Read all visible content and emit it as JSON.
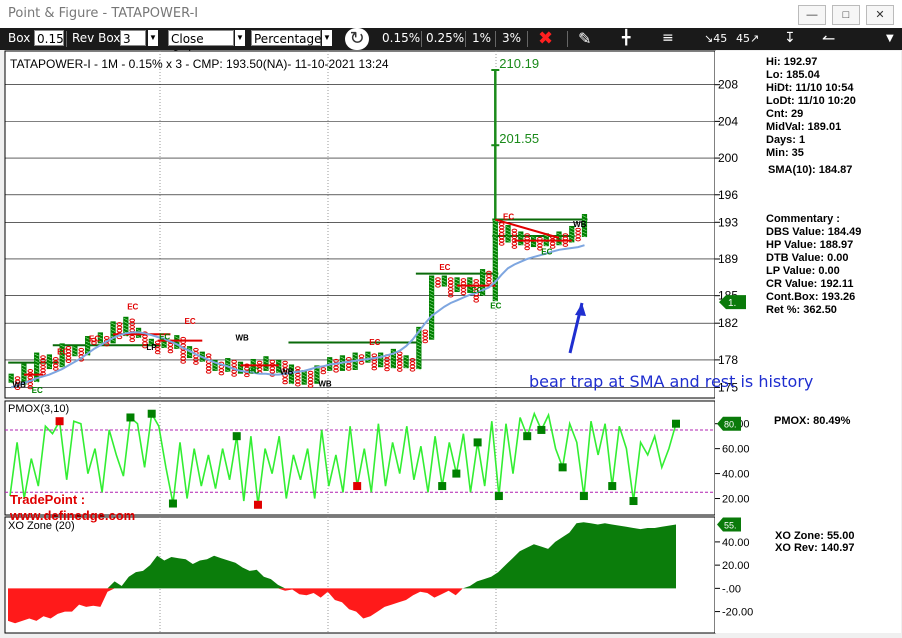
{
  "window": {
    "title": "Point & Figure - TATAPOWER-I",
    "minimize_icon": "minimize-icon",
    "restore_icon": "restore-icon",
    "close_icon": "close-icon"
  },
  "toolbar": {
    "box_label": "Box",
    "box_value": "0.15",
    "rev_label": "Rev Box",
    "rev_value": "3",
    "mode_value": "Close Only",
    "scale_value": "Percentage",
    "presets": [
      "0.15%",
      "0.25%",
      "1%",
      "3%"
    ],
    "icons": [
      "refresh-icon",
      "close-x-icon",
      "draw-icon",
      "candle-icon",
      "lines-icon",
      "angle-45-down-icon",
      "angle-45-up-icon",
      "pin-icon",
      "step-icon"
    ]
  },
  "chart_header": "TATAPOWER-I - 1M - 0.15% x 3 - CMP: 193.50(NA)- 11-10-2021 13:24",
  "stats": {
    "hi": "Hi: 192.97",
    "lo": "Lo: 185.04",
    "hidt": "HiDt: 11/10 10:54",
    "lodt": "LoDt: 11/10 10:20",
    "cnt": "Cnt: 29",
    "midval": "MidVal: 189.01",
    "days": "Days: 1",
    "min": "Min: 35",
    "sma": "SMA(10): 184.87"
  },
  "commentary": {
    "title": "Commentary :",
    "dbs": "DBS Value:  184.49",
    "hp": "HP Value: 188.97",
    "dtb": "DTB Value: 0.00",
    "lp": "LP Value: 0.00",
    "cr": "CR Value: 192.11",
    "cont": "Cont.Box: 193.26",
    "ret": "Ret %: 362.50"
  },
  "annotation": "bear trap at SMA and rest is history",
  "brand": {
    "line1": "TradePoint :",
    "line2": "www.definedge.com"
  },
  "pmox_panel": {
    "label": "PMOX(3,10)",
    "readout": "PMOX: 80.49%",
    "marker": "80."
  },
  "xo_panel": {
    "label": "XO Zone (20)",
    "readout1": "XO Zone: 55.00",
    "readout2": "XO Rev: 140.97",
    "marker": "55."
  },
  "colors": {
    "bull": "#008000",
    "bear": "#e00000",
    "sma": "#7ea6e0",
    "pmox_line": "#33ee33",
    "level": "#0a6a0a",
    "target": "#1a8a1a",
    "arrow": "#1f2ed0"
  },
  "chart_data": [
    {
      "type": "line",
      "name": "price_pnf",
      "yticks": [
        175,
        178,
        182,
        185,
        189,
        193,
        196,
        200,
        204,
        208
      ],
      "ylim": [
        174.5,
        210.8
      ],
      "columns": [
        {
          "t": "X",
          "lo": 175.5,
          "hi": 176.5
        },
        {
          "t": "O",
          "lo": 174.8,
          "hi": 176.2
        },
        {
          "t": "X",
          "lo": 175.3,
          "hi": 177.6
        },
        {
          "t": "O",
          "lo": 175.0,
          "hi": 177.0
        },
        {
          "t": "X",
          "lo": 175.6,
          "hi": 178.8
        },
        {
          "t": "O",
          "lo": 176.4,
          "hi": 178.5
        },
        {
          "t": "X",
          "lo": 177.0,
          "hi": 178.6
        },
        {
          "t": "O",
          "lo": 176.8,
          "hi": 178.3
        },
        {
          "t": "X",
          "lo": 177.2,
          "hi": 179.8
        },
        {
          "t": "O",
          "lo": 177.8,
          "hi": 179.5
        },
        {
          "t": "X",
          "lo": 178.4,
          "hi": 179.6
        },
        {
          "t": "O",
          "lo": 178.0,
          "hi": 179.3
        },
        {
          "t": "X",
          "lo": 178.5,
          "hi": 180.6
        },
        {
          "t": "O",
          "lo": 179.6,
          "hi": 180.4
        },
        {
          "t": "X",
          "lo": 179.8,
          "hi": 181.0
        },
        {
          "t": "O",
          "lo": 179.4,
          "hi": 180.6
        },
        {
          "t": "X",
          "lo": 179.8,
          "hi": 182.2
        },
        {
          "t": "O",
          "lo": 180.2,
          "hi": 182.1
        },
        {
          "t": "X",
          "lo": 180.6,
          "hi": 182.7
        },
        {
          "t": "O",
          "lo": 180.0,
          "hi": 182.5
        },
        {
          "t": "X",
          "lo": 180.4,
          "hi": 181.5
        },
        {
          "t": "O",
          "lo": 179.4,
          "hi": 181.1
        },
        {
          "t": "X",
          "lo": 179.6,
          "hi": 180.3
        },
        {
          "t": "O",
          "lo": 178.8,
          "hi": 180.1
        },
        {
          "t": "X",
          "lo": 179.3,
          "hi": 180.4
        },
        {
          "t": "O",
          "lo": 178.6,
          "hi": 180.2
        },
        {
          "t": "X",
          "lo": 179.2,
          "hi": 180.7
        },
        {
          "t": "O",
          "lo": 177.6,
          "hi": 180.5
        },
        {
          "t": "X",
          "lo": 178.2,
          "hi": 179.5
        },
        {
          "t": "O",
          "lo": 177.4,
          "hi": 179.3
        },
        {
          "t": "X",
          "lo": 177.8,
          "hi": 178.9
        },
        {
          "t": "O",
          "lo": 176.5,
          "hi": 178.7
        },
        {
          "t": "X",
          "lo": 176.8,
          "hi": 178.0
        },
        {
          "t": "O",
          "lo": 176.4,
          "hi": 177.8
        },
        {
          "t": "X",
          "lo": 176.7,
          "hi": 178.2
        },
        {
          "t": "O",
          "lo": 176.2,
          "hi": 178.0
        },
        {
          "t": "X",
          "lo": 176.5,
          "hi": 177.8
        },
        {
          "t": "O",
          "lo": 176.3,
          "hi": 177.6
        },
        {
          "t": "X",
          "lo": 176.5,
          "hi": 178.1
        },
        {
          "t": "O",
          "lo": 176.4,
          "hi": 177.9
        },
        {
          "t": "X",
          "lo": 176.8,
          "hi": 178.4
        },
        {
          "t": "O",
          "lo": 176.3,
          "hi": 178.0
        },
        {
          "t": "X",
          "lo": 176.6,
          "hi": 178.0
        },
        {
          "t": "O",
          "lo": 175.2,
          "hi": 177.9
        },
        {
          "t": "X",
          "lo": 175.4,
          "hi": 177.5
        },
        {
          "t": "O",
          "lo": 175.0,
          "hi": 177.3
        },
        {
          "t": "X",
          "lo": 175.3,
          "hi": 176.9
        },
        {
          "t": "O",
          "lo": 175.0,
          "hi": 176.8
        },
        {
          "t": "X",
          "lo": 175.4,
          "hi": 177.4
        },
        {
          "t": "O",
          "lo": 176.6,
          "hi": 177.2
        },
        {
          "t": "X",
          "lo": 176.8,
          "hi": 178.3
        },
        {
          "t": "O",
          "lo": 176.6,
          "hi": 178.1
        },
        {
          "t": "X",
          "lo": 176.8,
          "hi": 178.5
        },
        {
          "t": "O",
          "lo": 176.7,
          "hi": 178.3
        },
        {
          "t": "X",
          "lo": 176.9,
          "hi": 178.8
        },
        {
          "t": "O",
          "lo": 177.5,
          "hi": 178.6
        },
        {
          "t": "X",
          "lo": 177.7,
          "hi": 178.9
        },
        {
          "t": "O",
          "lo": 177.0,
          "hi": 178.7
        },
        {
          "t": "X",
          "lo": 177.2,
          "hi": 178.8
        },
        {
          "t": "O",
          "lo": 176.9,
          "hi": 178.6
        },
        {
          "t": "X",
          "lo": 177.1,
          "hi": 179.2
        },
        {
          "t": "O",
          "lo": 176.8,
          "hi": 178.9
        },
        {
          "t": "X",
          "lo": 177.1,
          "hi": 178.5
        },
        {
          "t": "O",
          "lo": 176.8,
          "hi": 178.2
        },
        {
          "t": "X",
          "lo": 177.0,
          "hi": 181.6
        },
        {
          "t": "O",
          "lo": 180.0,
          "hi": 181.3
        },
        {
          "t": "X",
          "lo": 180.2,
          "hi": 187.2
        },
        {
          "t": "O",
          "lo": 185.8,
          "hi": 187.0
        },
        {
          "t": "X",
          "lo": 186.0,
          "hi": 187.2
        },
        {
          "t": "O",
          "lo": 185.0,
          "hi": 187.0
        },
        {
          "t": "X",
          "lo": 185.4,
          "hi": 187.0
        },
        {
          "t": "O",
          "lo": 185.1,
          "hi": 186.9
        },
        {
          "t": "X",
          "lo": 185.3,
          "hi": 187.0
        },
        {
          "t": "O",
          "lo": 184.4,
          "hi": 186.8
        },
        {
          "t": "X",
          "lo": 185.0,
          "hi": 187.9
        },
        {
          "t": "O",
          "lo": 186.1,
          "hi": 187.7
        },
        {
          "t": "X",
          "lo": 184.4,
          "hi": 193.4
        },
        {
          "t": "O",
          "lo": 190.4,
          "hi": 193.0
        },
        {
          "t": "X",
          "lo": 190.8,
          "hi": 192.7
        },
        {
          "t": "O",
          "lo": 190.2,
          "hi": 192.3
        },
        {
          "t": "X",
          "lo": 190.5,
          "hi": 192.0
        },
        {
          "t": "O",
          "lo": 190.0,
          "hi": 191.8
        },
        {
          "t": "X",
          "lo": 190.3,
          "hi": 191.6
        },
        {
          "t": "O",
          "lo": 190.0,
          "hi": 191.4
        },
        {
          "t": "X",
          "lo": 190.4,
          "hi": 191.8
        },
        {
          "t": "O",
          "lo": 190.2,
          "hi": 191.6
        },
        {
          "t": "X",
          "lo": 190.5,
          "hi": 192.0
        },
        {
          "t": "O",
          "lo": 190.4,
          "hi": 191.8
        },
        {
          "t": "X",
          "lo": 190.8,
          "hi": 192.6
        },
        {
          "t": "O",
          "lo": 191.1,
          "hi": 192.4
        },
        {
          "t": "X",
          "lo": 191.4,
          "hi": 193.9
        }
      ],
      "targets": [
        {
          "label": "210.19",
          "value": 209.6
        },
        {
          "label": "201.55",
          "value": 201.4
        }
      ],
      "sma": [
        175.0,
        175.2,
        175.5,
        175.7,
        176.0,
        176.2,
        176.4,
        176.7,
        177.0,
        177.4,
        177.8,
        178.2,
        178.7,
        179.2,
        179.6,
        180.0,
        180.4,
        180.7,
        180.9,
        181.0,
        181.0,
        180.9,
        180.7,
        180.5,
        180.3,
        180.0,
        179.7,
        179.3,
        179.0,
        178.6,
        178.3,
        178.0,
        177.7,
        177.5,
        177.3,
        177.0,
        176.8,
        176.7,
        176.6,
        176.5,
        176.5,
        176.4,
        176.4,
        176.5,
        176.6,
        176.7,
        176.8,
        177.0,
        177.2,
        177.3,
        177.5,
        177.6,
        177.7,
        177.8,
        177.9,
        178.0,
        178.1,
        178.2,
        178.3,
        178.5,
        178.7,
        179.0,
        179.5,
        180.2,
        181.1,
        182.0,
        182.8,
        183.3,
        183.8,
        184.2,
        184.5,
        184.8,
        185.1,
        185.3,
        185.6,
        185.9,
        186.5,
        187.3,
        188.0,
        188.4,
        188.7,
        189.0,
        189.2,
        189.4,
        189.6,
        189.8,
        190.0,
        190.1,
        190.2,
        190.3,
        190.5
      ],
      "levels": [
        {
          "value": 177.7,
          "from": 0,
          "to": 7
        },
        {
          "value": 179.6,
          "from": 7,
          "to": 23
        },
        {
          "value": 179.9,
          "from": 44,
          "to": 64
        },
        {
          "value": 187.4,
          "from": 64,
          "to": 76
        },
        {
          "value": 193.3,
          "from": 76,
          "to": 90
        },
        {
          "value": 191.5,
          "from": 76,
          "to": 88
        }
      ],
      "red_lines": [
        {
          "x1": 2,
          "y1": 176.4,
          "x2": 5,
          "y2": 176.4
        },
        {
          "x1": 16,
          "y1": 180.8,
          "x2": 25,
          "y2": 180.8
        },
        {
          "x1": 23,
          "y1": 180.1,
          "x2": 30,
          "y2": 180.1
        },
        {
          "x1": 36,
          "y1": 177.4,
          "x2": 42,
          "y2": 177.4
        },
        {
          "x1": 70,
          "y1": 186.1,
          "x2": 76,
          "y2": 186.1
        },
        {
          "x1": 76,
          "y1": 193.3,
          "x2": 86,
          "y2": 191.3
        },
        {
          "x1": 79,
          "y1": 191.0,
          "x2": 88,
          "y2": 191.0
        }
      ],
      "labels": [
        {
          "text": "WB",
          "x": 1,
          "y": 175.0,
          "color": "#000000"
        },
        {
          "text": "EC",
          "x": 4,
          "y": 174.4,
          "color": "#008000"
        },
        {
          "text": "EC",
          "x": 8,
          "y": 178.6,
          "color": "#e00000"
        },
        {
          "text": "EC",
          "x": 13,
          "y": 180.0,
          "color": "#e00000"
        },
        {
          "text": "EC",
          "x": 19,
          "y": 183.5,
          "color": "#e00000"
        },
        {
          "text": "LP",
          "x": 22,
          "y": 179.1,
          "color": "#000000"
        },
        {
          "text": "EC",
          "x": 24,
          "y": 180.2,
          "color": "#008000"
        },
        {
          "text": "EC",
          "x": 28,
          "y": 181.9,
          "color": "#e00000"
        },
        {
          "text": "WB",
          "x": 36,
          "y": 180.1,
          "color": "#000000"
        },
        {
          "text": "EC",
          "x": 38,
          "y": 176.5,
          "color": "#008000"
        },
        {
          "text": "WB",
          "x": 43,
          "y": 176.4,
          "color": "#000000"
        },
        {
          "text": "WB",
          "x": 49,
          "y": 175.1,
          "color": "#000000"
        },
        {
          "text": "EC",
          "x": 57,
          "y": 179.6,
          "color": "#e00000"
        },
        {
          "text": "EC",
          "x": 68,
          "y": 187.8,
          "color": "#e00000"
        },
        {
          "text": "EC",
          "x": 73,
          "y": 185.3,
          "color": "#008000"
        },
        {
          "text": "EC",
          "x": 76,
          "y": 183.6,
          "color": "#008000"
        },
        {
          "text": "EC",
          "x": 78,
          "y": 193.3,
          "color": "#e00000"
        },
        {
          "text": "EC",
          "x": 84,
          "y": 189.5,
          "color": "#008000"
        },
        {
          "text": "WB",
          "x": 89,
          "y": 192.5,
          "color": "#000000"
        }
      ]
    },
    {
      "type": "line",
      "name": "pmox",
      "ylim": [
        10,
        95
      ],
      "yticks": [
        20,
        40,
        60,
        80
      ],
      "bands": [
        25,
        75
      ],
      "values": [
        22,
        65,
        20,
        52,
        30,
        78,
        72,
        82,
        35,
        82,
        80,
        40,
        60,
        25,
        75,
        55,
        38,
        85,
        80,
        45,
        88,
        78,
        45,
        16,
        65,
        20,
        60,
        30,
        55,
        28,
        60,
        35,
        70,
        18,
        70,
        15,
        60,
        40,
        70,
        20,
        55,
        35,
        60,
        20,
        75,
        30,
        55,
        25,
        78,
        30,
        60,
        25,
        80,
        30,
        65,
        40,
        78,
        35,
        62,
        25,
        70,
        30,
        65,
        40,
        72,
        25,
        65,
        30,
        82,
        22,
        80,
        40,
        85,
        70,
        88,
        75,
        87,
        60,
        45,
        80,
        65,
        22,
        82,
        55,
        80,
        30,
        78,
        60,
        18,
        65,
        55,
        70,
        45,
        60,
        80
      ],
      "markers": [
        {
          "i": 7,
          "c": "#e00000"
        },
        {
          "i": 17,
          "c": "#008000"
        },
        {
          "i": 20,
          "c": "#008000"
        },
        {
          "i": 23,
          "c": "#008000"
        },
        {
          "i": 32,
          "c": "#008000"
        },
        {
          "i": 35,
          "c": "#e00000"
        },
        {
          "i": 49,
          "c": "#e00000"
        },
        {
          "i": 61,
          "c": "#008000"
        },
        {
          "i": 63,
          "c": "#008000"
        },
        {
          "i": 66,
          "c": "#008000"
        },
        {
          "i": 69,
          "c": "#008000"
        },
        {
          "i": 73,
          "c": "#008000"
        },
        {
          "i": 75,
          "c": "#008000"
        },
        {
          "i": 78,
          "c": "#008000"
        },
        {
          "i": 81,
          "c": "#008000"
        },
        {
          "i": 85,
          "c": "#008000"
        },
        {
          "i": 88,
          "c": "#008000"
        },
        {
          "i": 94,
          "c": "#008000"
        }
      ]
    },
    {
      "type": "area",
      "name": "xo_zone",
      "ylim": [
        -35,
        58
      ],
      "yticks": [
        -20,
        0,
        20,
        40
      ],
      "ticklabels": [
        "-20.00",
        "-.00",
        "20.00",
        "40.00"
      ],
      "values": [
        -28,
        -30,
        -28,
        -26,
        -28,
        -24,
        -26,
        -22,
        -20,
        -20,
        -14,
        -16,
        -15,
        -16,
        -3,
        6,
        2,
        10,
        14,
        15,
        20,
        28,
        24,
        27,
        26,
        25,
        21,
        24,
        25,
        28,
        26,
        24,
        22,
        18,
        15,
        16,
        10,
        8,
        3,
        -2,
        -1,
        -5,
        -6,
        -4,
        -8,
        -3,
        -10,
        -12,
        -18,
        -20,
        -26,
        -24,
        -20,
        -16,
        -14,
        -12,
        -10,
        -6,
        -3,
        -4,
        -8,
        -5,
        -2,
        -6,
        0,
        2,
        6,
        8,
        10,
        14,
        20,
        26,
        32,
        35,
        38,
        36,
        34,
        40,
        44,
        48,
        56,
        57,
        56,
        55,
        56,
        55,
        54,
        53,
        52,
        51,
        52,
        52,
        53,
        54,
        55
      ]
    }
  ]
}
